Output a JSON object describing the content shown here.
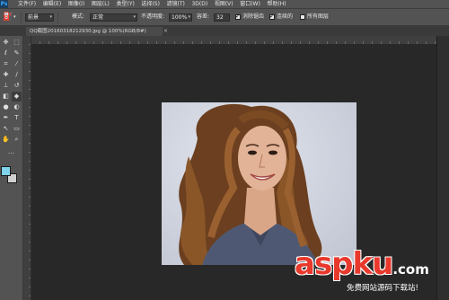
{
  "app": {
    "logo": "Ps"
  },
  "menu": [
    "文件(F)",
    "编辑(E)",
    "图像(I)",
    "图层(L)",
    "类型(Y)",
    "选择(S)",
    "滤镜(T)",
    "3D(D)",
    "视图(V)",
    "窗口(W)",
    "帮助(H)"
  ],
  "options": {
    "preset_label": "前景",
    "mode_label": "模式:",
    "mode_value": "正常",
    "opacity_label": "不透明度:",
    "opacity_value": "100%",
    "tolerance_label": "容差:",
    "tolerance_value": "32",
    "antialias_label": "消除锯齿",
    "antialias_checked": true,
    "contiguous_label": "连续的",
    "contiguous_checked": true,
    "alllayers_label": "所有图层",
    "alllayers_checked": false
  },
  "document": {
    "tab_title": "QQ截图20160318212930.jpg @ 100%(RGB/8#)",
    "close_glyph": "×"
  },
  "tools": [
    {
      "name": "move-icon",
      "glyph": "✥"
    },
    {
      "name": "marquee-icon",
      "glyph": "⬚"
    },
    {
      "name": "lasso-icon",
      "glyph": "ℓ"
    },
    {
      "name": "quick-select-icon",
      "glyph": "✎"
    },
    {
      "name": "crop-icon",
      "glyph": "⌗"
    },
    {
      "name": "eyedropper-icon",
      "glyph": "⁄"
    },
    {
      "name": "healing-icon",
      "glyph": "✚"
    },
    {
      "name": "brush-icon",
      "glyph": "∕"
    },
    {
      "name": "stamp-icon",
      "glyph": "⊥"
    },
    {
      "name": "history-brush-icon",
      "glyph": "↺"
    },
    {
      "name": "eraser-icon",
      "glyph": "◧"
    },
    {
      "name": "paint-bucket-icon",
      "glyph": "◆"
    },
    {
      "name": "blur-icon",
      "glyph": "●"
    },
    {
      "name": "dodge-icon",
      "glyph": "◐"
    },
    {
      "name": "pen-icon",
      "glyph": "✒"
    },
    {
      "name": "type-icon",
      "glyph": "T"
    },
    {
      "name": "path-select-icon",
      "glyph": "↖"
    },
    {
      "name": "shape-icon",
      "glyph": "▭"
    },
    {
      "name": "hand-icon",
      "glyph": "✋"
    },
    {
      "name": "zoom-icon",
      "glyph": "⌕"
    },
    {
      "name": "more-tools-icon",
      "glyph": "…"
    }
  ],
  "colors": {
    "foreground": "#7fd3ea",
    "background": "#d0d0d0"
  },
  "watermark": {
    "brand": "aspku",
    "tld": ".com",
    "tagline": "免费网站源码下载站!"
  }
}
